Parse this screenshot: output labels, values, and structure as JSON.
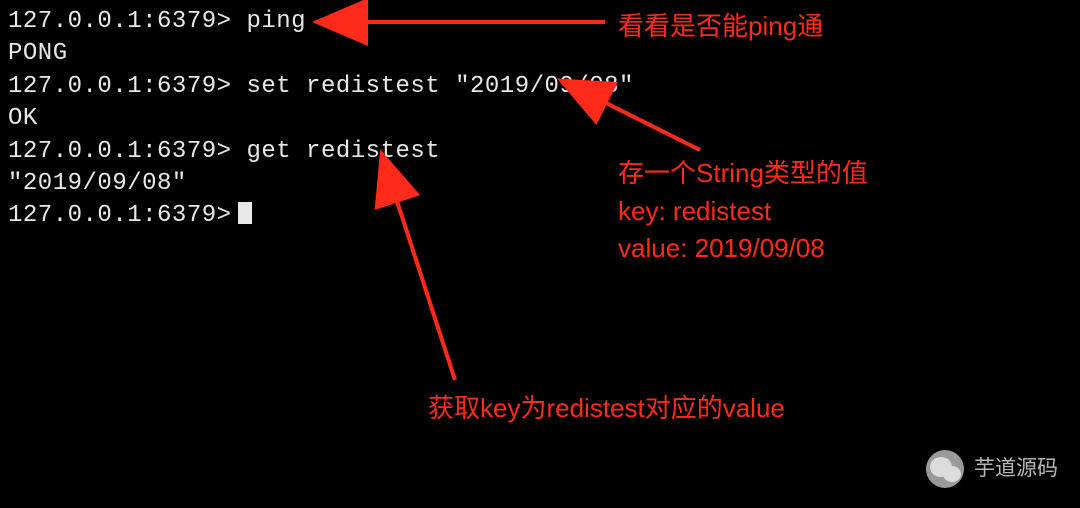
{
  "terminal": {
    "lines": [
      {
        "prompt": "127.0.0.1:6379>",
        "cmd": " ping"
      },
      {
        "text": "PONG"
      },
      {
        "prompt": "127.0.0.1:6379>",
        "cmd": " set redistest \"2019/09/08\""
      },
      {
        "text": "OK"
      },
      {
        "prompt": "127.0.0.1:6379>",
        "cmd": " get redistest"
      },
      {
        "text": "\"2019/09/08\""
      },
      {
        "prompt": "127.0.0.1:6379>",
        "cursor": true
      }
    ]
  },
  "annotations": {
    "a1": "看看是否能ping通",
    "a2_l1": "存一个String类型的值",
    "a2_l2": "key: redistest",
    "a2_l3": "value: 2019/09/08",
    "a3": "获取key为redistest对应的value"
  },
  "watermark": {
    "text": "芋道源码"
  },
  "colors": {
    "bg": "#000000",
    "text": "#e8e8e8",
    "annotation": "#ff2a1a"
  }
}
